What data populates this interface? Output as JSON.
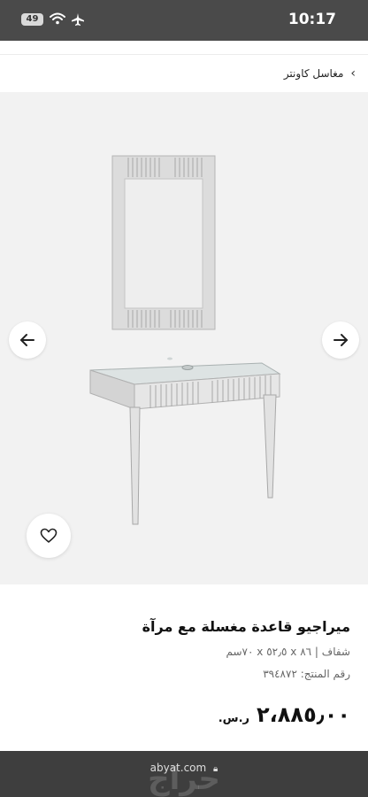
{
  "status_bar": {
    "time": "10:17",
    "battery": "49"
  },
  "breadcrumb": {
    "label": "مغاسل كاونتر"
  },
  "gallery": {
    "prev_label": "previous",
    "next_label": "next"
  },
  "product": {
    "title": "ميراجيو قاعدة مغسلة مع مرآة",
    "specs": "شفاف | ٨٦ x ٥٢٫٥ x ٧٠سم",
    "sku": "رقم المنتج: ٣٩٤٨٧٢",
    "price": "٢،٨٨٥٫٠٠",
    "currency": "ر.س."
  },
  "browser": {
    "url": "abyat.com"
  },
  "watermark": {
    "text": "حراج"
  },
  "icons": {
    "wifi": "wifi-icon",
    "airplane": "airplane-icon",
    "back": "chevron-left-icon",
    "prev": "arrow-left-icon",
    "next": "arrow-right-icon",
    "wishlist": "heart-icon",
    "lock": "lock-icon"
  },
  "colors": {
    "status_bar": "#4a4a4a",
    "gallery_bg": "#f2f2f2",
    "bottom_bar": "#3e3e3e"
  }
}
